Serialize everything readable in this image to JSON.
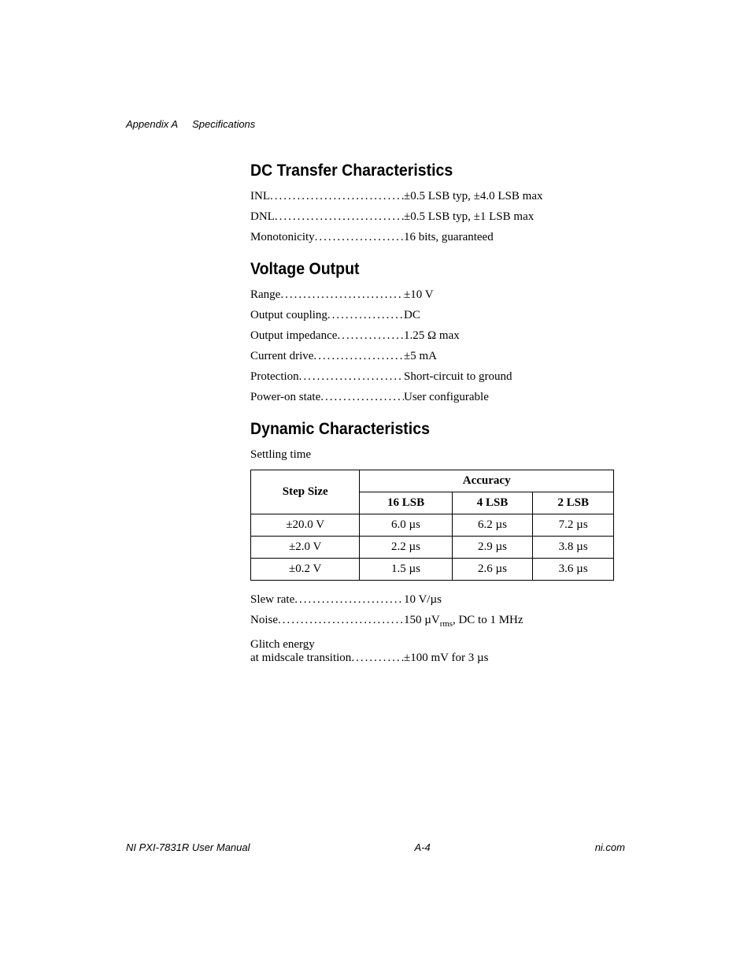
{
  "header": {
    "appendix": "Appendix A",
    "section": "Specifications"
  },
  "sections": {
    "dc": {
      "title": "DC Transfer Characteristics",
      "items": [
        {
          "label": "INL",
          "value": "±0.5 LSB typ, ±4.0 LSB max"
        },
        {
          "label": "DNL",
          "value": "±0.5 LSB typ, ±1 LSB max"
        },
        {
          "label": "Monotonicity",
          "value": "16 bits, guaranteed"
        }
      ]
    },
    "voltage": {
      "title": "Voltage Output",
      "items": [
        {
          "label": "Range",
          "value": "±10 V"
        },
        {
          "label": "Output coupling",
          "value": "DC"
        },
        {
          "label": "Output impedance",
          "value": "1.25 Ω max"
        },
        {
          "label": "Current drive",
          "value": "±5 mA"
        },
        {
          "label": "Protection",
          "value": "Short-circuit to ground"
        },
        {
          "label": "Power-on state",
          "value": "User configurable"
        }
      ]
    },
    "dynamic": {
      "title": "Dynamic Characteristics",
      "settling_label": "Settling time",
      "table": {
        "accuracy_header": "Accuracy",
        "step_header": "Step Size",
        "cols": [
          "16 LSB",
          "4 LSB",
          "2 LSB"
        ],
        "rows": [
          {
            "step": "±20.0 V",
            "cells": [
              "6.0 µs",
              "6.2 µs",
              "7.2 µs"
            ]
          },
          {
            "step": "±2.0 V",
            "cells": [
              "2.2 µs",
              "2.9 µs",
              "3.8 µs"
            ]
          },
          {
            "step": "±0.2 V",
            "cells": [
              "1.5 µs",
              "2.6 µs",
              "3.6 µs"
            ]
          }
        ]
      },
      "after": [
        {
          "label": "Slew rate",
          "value": "10 V/µs"
        },
        {
          "label": "Noise",
          "value_html": "150 µV<sub>rms</sub>, DC to 1 MHz"
        }
      ],
      "glitch": {
        "line1": "Glitch energy",
        "line2_label": "at midscale transition",
        "line2_value": "±100 mV for 3 µs"
      }
    }
  },
  "footer": {
    "left": "NI PXI-7831R User Manual",
    "center": "A-4",
    "right": "ni.com"
  }
}
